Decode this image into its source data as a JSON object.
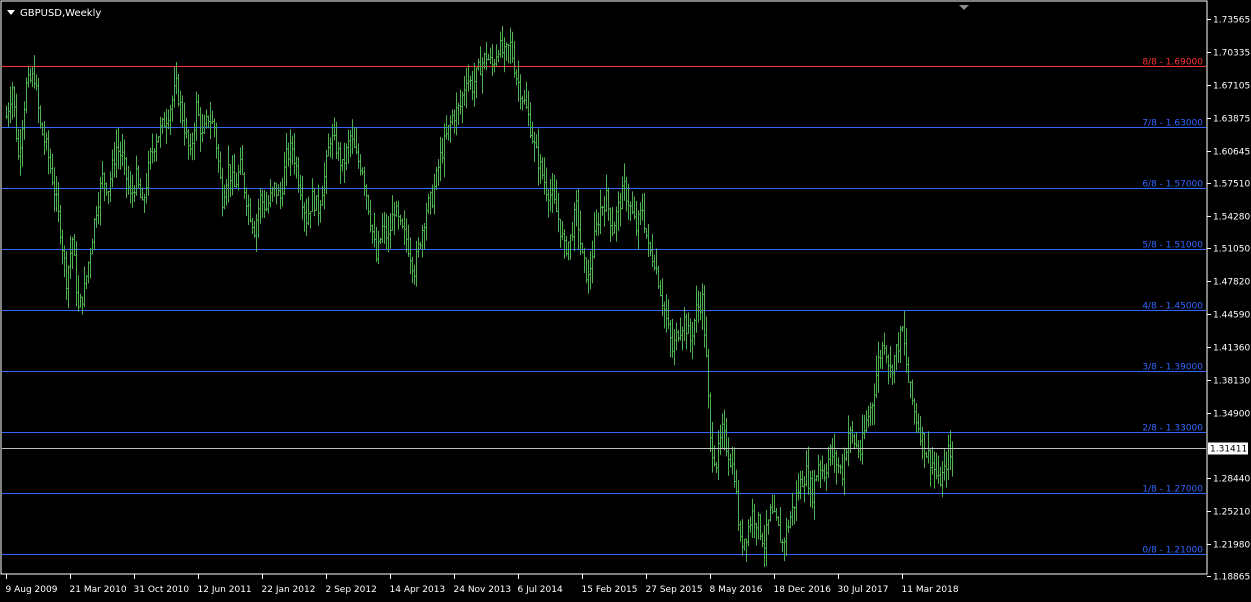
{
  "window": {
    "title": "GBPUSD,Weekly",
    "menu_icon": "triangle-down-icon",
    "shift_marker_icon": "triangle-down-icon"
  },
  "colors": {
    "background": "#000000",
    "bars": "#4caf50",
    "top_level_line": "#ff3333",
    "level_line": "#3366ff",
    "price_axis_text": "#ffffff",
    "current_price_box": "#ffffff",
    "current_price_text": "#000000",
    "level_label": "#3366ff",
    "top_level_label": "#ff3333"
  },
  "chart_data": {
    "type": "ohlc-bar",
    "symbol": "GBPUSD",
    "timeframe": "Weekly",
    "ylim": [
      1.1885,
      1.739
    ],
    "y_ticks": [
      "1.73565",
      "1.70335",
      "1.67105",
      "1.63875",
      "1.60645",
      "1.57510",
      "1.54280",
      "1.51050",
      "1.47820",
      "1.44590",
      "1.41360",
      "1.38130",
      "1.34900",
      "1.31411",
      "1.28440",
      "1.25210",
      "1.21980",
      "1.18865"
    ],
    "y_tick_values": [
      1.73565,
      1.70335,
      1.67105,
      1.63875,
      1.60645,
      1.5751,
      1.5428,
      1.5105,
      1.4782,
      1.4459,
      1.4136,
      1.3813,
      1.349,
      1.31411,
      1.2844,
      1.2521,
      1.2198,
      1.18865
    ],
    "x_ticks": [
      "9 Aug 2009",
      "21 Mar 2010",
      "31 Oct 2010",
      "12 Jun 2011",
      "22 Jan 2012",
      "2 Sep 2012",
      "14 Apr 2013",
      "24 Nov 2013",
      "6 Jul 2014",
      "15 Feb 2015",
      "27 Sep 2015",
      "8 May 2016",
      "18 Dec 2016",
      "30 Jul 2017",
      "11 Mar 2018"
    ],
    "x_tick_bar_index": [
      0,
      32,
      64,
      96,
      128,
      160,
      192,
      224,
      256,
      288,
      320,
      352,
      384,
      416,
      448
    ],
    "current_price": 1.31411,
    "current_price_label": "1.31411",
    "murrey_levels": [
      {
        "label": "8/8 - 1.69000",
        "value": 1.69,
        "color": "#ff3333"
      },
      {
        "label": "7/8 - 1.63000",
        "value": 1.63,
        "color": "#3366ff"
      },
      {
        "label": "6/8 - 1.57000",
        "value": 1.57,
        "color": "#3366ff"
      },
      {
        "label": "5/8 - 1.51000",
        "value": 1.51,
        "color": "#3366ff"
      },
      {
        "label": "4/8 - 1.45000",
        "value": 1.45,
        "color": "#3366ff"
      },
      {
        "label": "3/8 - 1.39000",
        "value": 1.39,
        "color": "#3366ff"
      },
      {
        "label": "2/8 - 1.33000",
        "value": 1.33,
        "color": "#3366ff"
      },
      {
        "label": "1/8 - 1.27000",
        "value": 1.27,
        "color": "#3366ff"
      },
      {
        "label": "0/8 - 1.21000",
        "value": 1.21,
        "color": "#3366ff"
      }
    ],
    "close_path": [
      [
        0,
        1.64
      ],
      [
        3,
        1.67
      ],
      [
        6,
        1.6
      ],
      [
        10,
        1.67
      ],
      [
        14,
        1.68
      ],
      [
        17,
        1.63
      ],
      [
        20,
        1.61
      ],
      [
        23,
        1.58
      ],
      [
        27,
        1.53
      ],
      [
        30,
        1.48
      ],
      [
        33,
        1.52
      ],
      [
        36,
        1.45
      ],
      [
        39,
        1.47
      ],
      [
        42,
        1.51
      ],
      [
        45,
        1.55
      ],
      [
        48,
        1.58
      ],
      [
        51,
        1.57
      ],
      [
        55,
        1.61
      ],
      [
        58,
        1.6
      ],
      [
        62,
        1.56
      ],
      [
        65,
        1.58
      ],
      [
        68,
        1.55
      ],
      [
        72,
        1.6
      ],
      [
        75,
        1.62
      ],
      [
        78,
        1.63
      ],
      [
        82,
        1.65
      ],
      [
        85,
        1.67
      ],
      [
        88,
        1.64
      ],
      [
        92,
        1.6
      ],
      [
        95,
        1.65
      ],
      [
        98,
        1.62
      ],
      [
        101,
        1.64
      ],
      [
        104,
        1.63
      ],
      [
        108,
        1.56
      ],
      [
        111,
        1.59
      ],
      [
        114,
        1.57
      ],
      [
        117,
        1.59
      ],
      [
        120,
        1.56
      ],
      [
        124,
        1.53
      ],
      [
        127,
        1.56
      ],
      [
        130,
        1.55
      ],
      [
        134,
        1.57
      ],
      [
        137,
        1.56
      ],
      [
        140,
        1.6
      ],
      [
        143,
        1.61
      ],
      [
        147,
        1.57
      ],
      [
        150,
        1.54
      ],
      [
        153,
        1.56
      ],
      [
        156,
        1.55
      ],
      [
        159,
        1.58
      ],
      [
        162,
        1.62
      ],
      [
        165,
        1.61
      ],
      [
        168,
        1.59
      ],
      [
        172,
        1.62
      ],
      [
        175,
        1.6
      ],
      [
        178,
        1.59
      ],
      [
        182,
        1.54
      ],
      [
        185,
        1.5
      ],
      [
        188,
        1.53
      ],
      [
        191,
        1.52
      ],
      [
        194,
        1.55
      ],
      [
        197,
        1.53
      ],
      [
        200,
        1.52
      ],
      [
        204,
        1.49
      ],
      [
        207,
        1.52
      ],
      [
        210,
        1.55
      ],
      [
        213,
        1.56
      ],
      [
        217,
        1.6
      ],
      [
        220,
        1.62
      ],
      [
        223,
        1.64
      ],
      [
        227,
        1.65
      ],
      [
        230,
        1.68
      ],
      [
        233,
        1.67
      ],
      [
        237,
        1.69
      ],
      [
        240,
        1.7
      ],
      [
        243,
        1.69
      ],
      [
        246,
        1.71
      ],
      [
        249,
        1.7
      ],
      [
        252,
        1.71
      ],
      [
        255,
        1.68
      ],
      [
        258,
        1.66
      ],
      [
        261,
        1.64
      ],
      [
        264,
        1.61
      ],
      [
        267,
        1.59
      ],
      [
        270,
        1.57
      ],
      [
        273,
        1.56
      ],
      [
        276,
        1.54
      ],
      [
        279,
        1.51
      ],
      [
        282,
        1.52
      ],
      [
        285,
        1.55
      ],
      [
        288,
        1.5
      ],
      [
        291,
        1.48
      ],
      [
        294,
        1.52
      ],
      [
        297,
        1.55
      ],
      [
        300,
        1.56
      ],
      [
        303,
        1.53
      ],
      [
        306,
        1.55
      ],
      [
        309,
        1.57
      ],
      [
        312,
        1.55
      ],
      [
        315,
        1.53
      ],
      [
        318,
        1.55
      ],
      [
        321,
        1.51
      ],
      [
        324,
        1.5
      ],
      [
        327,
        1.47
      ],
      [
        330,
        1.44
      ],
      [
        333,
        1.41
      ],
      [
        336,
        1.43
      ],
      [
        339,
        1.44
      ],
      [
        342,
        1.42
      ],
      [
        345,
        1.45
      ],
      [
        348,
        1.46
      ],
      [
        350,
        1.4
      ],
      [
        352,
        1.32
      ],
      [
        355,
        1.3
      ],
      [
        358,
        1.33
      ],
      [
        361,
        1.31
      ],
      [
        364,
        1.29
      ],
      [
        367,
        1.22
      ],
      [
        370,
        1.23
      ],
      [
        373,
        1.25
      ],
      [
        376,
        1.24
      ],
      [
        379,
        1.22
      ],
      [
        382,
        1.25
      ],
      [
        385,
        1.24
      ],
      [
        388,
        1.22
      ],
      [
        391,
        1.24
      ],
      [
        394,
        1.26
      ],
      [
        397,
        1.28
      ],
      [
        400,
        1.29
      ],
      [
        403,
        1.27
      ],
      [
        406,
        1.3
      ],
      [
        409,
        1.29
      ],
      [
        412,
        1.31
      ],
      [
        415,
        1.3
      ],
      [
        418,
        1.29
      ],
      [
        421,
        1.33
      ],
      [
        424,
        1.32
      ],
      [
        427,
        1.31
      ],
      [
        430,
        1.34
      ],
      [
        433,
        1.36
      ],
      [
        436,
        1.4
      ],
      [
        439,
        1.42
      ],
      [
        442,
        1.39
      ],
      [
        445,
        1.41
      ],
      [
        448,
        1.43
      ],
      [
        451,
        1.38
      ],
      [
        454,
        1.35
      ],
      [
        457,
        1.33
      ],
      [
        460,
        1.31
      ],
      [
        463,
        1.3
      ],
      [
        466,
        1.28
      ],
      [
        469,
        1.29
      ],
      [
        471,
        1.31
      ],
      [
        473,
        1.3
      ]
    ],
    "typical_bar_range": 0.028,
    "x_axis_bar_count": 474
  }
}
